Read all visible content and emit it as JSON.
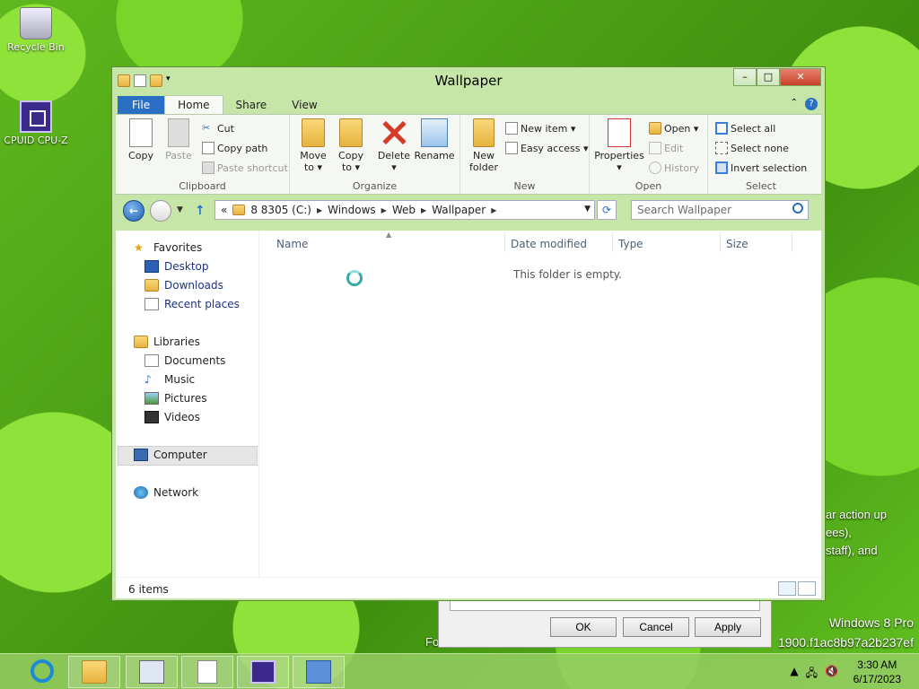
{
  "desktop": {
    "icons": [
      {
        "label": "Recycle Bin",
        "icon": "recycle-bin-icon"
      },
      {
        "label": "CPUID CPU-Z",
        "icon": "cpu-z-icon"
      }
    ],
    "overlay_lines": [
      "ar action up",
      "ees),",
      "staff), and"
    ],
    "bg_text_fragment": "Fo",
    "watermark": {
      "line1": "Windows 8 Pro",
      "line2": "1900.f1ac8b97a2b237ef"
    }
  },
  "bg_dialog": {
    "ok": "OK",
    "cancel": "Cancel",
    "apply": "Apply"
  },
  "window": {
    "title": "Wallpaper",
    "tabs": [
      "File",
      "Home",
      "Share",
      "View"
    ],
    "ribbon": {
      "clipboard": {
        "label": "Clipboard",
        "copy": "Copy",
        "paste": "Paste",
        "cut": "Cut",
        "copy_path": "Copy path",
        "paste_shortcut": "Paste shortcut"
      },
      "organize": {
        "label": "Organize",
        "move_to": "Move",
        "move_to2": "to ▾",
        "copy_to": "Copy",
        "copy_to2": "to ▾",
        "delete": "Delete",
        "delete2": "▾",
        "rename": "Rename"
      },
      "new": {
        "label": "New",
        "new_folder": "New",
        "new_folder2": "folder",
        "new_item": "New item ▾",
        "easy_access": "Easy access ▾"
      },
      "open": {
        "label": "Open",
        "properties": "Properties",
        "properties2": "▾",
        "open": "Open ▾",
        "edit": "Edit",
        "history": "History"
      },
      "select": {
        "label": "Select",
        "select_all": "Select all",
        "select_none": "Select none",
        "invert": "Invert selection"
      }
    },
    "address": {
      "prefix": "«",
      "segments": [
        "8 8305 (C:)",
        "Windows",
        "Web",
        "Wallpaper"
      ],
      "search_placeholder": "Search Wallpaper"
    },
    "nav": {
      "favorites": "Favorites",
      "favorites_items": [
        "Desktop",
        "Downloads",
        "Recent places"
      ],
      "libraries": "Libraries",
      "libraries_items": [
        "Documents",
        "Music",
        "Pictures",
        "Videos"
      ],
      "computer": "Computer",
      "network": "Network"
    },
    "columns": [
      "Name",
      "Date modified",
      "Type",
      "Size"
    ],
    "empty_message": "This folder is empty.",
    "status": "6 items"
  },
  "taskbar": {
    "clock_time": "3:30 AM",
    "clock_date": "6/17/2023",
    "items": [
      "internet-explorer-icon",
      "file-explorer-icon",
      "performance-monitor-icon",
      "notepad-icon",
      "cpu-z-icon",
      "control-panel-icon"
    ]
  }
}
